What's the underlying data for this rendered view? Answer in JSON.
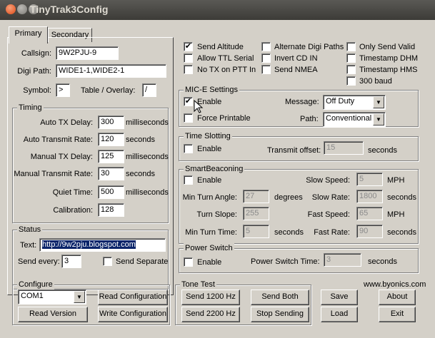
{
  "window": {
    "title": "TinyTrak3Config"
  },
  "tabs": [
    {
      "label": "Primary"
    },
    {
      "label": "Secondary"
    }
  ],
  "primary": {
    "callsign_label": "Callsign:",
    "callsign_value": "9W2PJU-9",
    "digipath_label": "Digi Path:",
    "digipath_value": "WIDE1-1,WIDE2-1",
    "symbol_label": "Symbol:",
    "symbol_value": ">",
    "table_label": "Table / Overlay:",
    "table_value": "/"
  },
  "timing": {
    "title": "Timing",
    "rows": [
      {
        "label": "Auto TX Delay:",
        "value": "300",
        "unit": "milliseconds"
      },
      {
        "label": "Auto Transmit Rate:",
        "value": "120",
        "unit": "seconds"
      },
      {
        "label": "Manual TX Delay:",
        "value": "125",
        "unit": "milliseconds"
      },
      {
        "label": "Manual Transmit Rate:",
        "value": "30",
        "unit": "seconds"
      },
      {
        "label": "Quiet Time:",
        "value": "500",
        "unit": "milliseconds"
      },
      {
        "label": "Calibration:",
        "value": "128",
        "unit": ""
      }
    ]
  },
  "status": {
    "title": "Status",
    "text_label": "Text:",
    "text_value": "http://9w2pju.blogspot.com",
    "send_every_label": "Send every:",
    "send_every_value": "3",
    "send_separate_label": "Send Separate"
  },
  "options": [
    {
      "label": "Send Altitude",
      "checked": true
    },
    {
      "label": "Alternate Digi Paths",
      "checked": false
    },
    {
      "label": "Only Send Valid",
      "checked": false
    },
    {
      "label": "Allow TTL Serial",
      "checked": false
    },
    {
      "label": "Invert CD IN",
      "checked": false
    },
    {
      "label": "Timestamp DHM",
      "checked": false
    },
    {
      "label": "No TX on PTT In",
      "checked": false
    },
    {
      "label": "Send NMEA",
      "checked": false
    },
    {
      "label": "Timestamp HMS",
      "checked": false
    },
    {
      "label": "300 baud",
      "checked": false
    }
  ],
  "mice": {
    "title": "MIC-E Settings",
    "enable_label": "Enable",
    "enable_checked": true,
    "force_label": "Force Printable",
    "force_checked": false,
    "message_label": "Message:",
    "message_value": "Off Duty",
    "path_label": "Path:",
    "path_value": "Conventional"
  },
  "timeslot": {
    "title": "Time Slotting",
    "enable_label": "Enable",
    "offset_label": "Transmit offset:",
    "offset_value": "15",
    "offset_unit": "seconds"
  },
  "smartbeaconing": {
    "title": "SmartBeaconing",
    "enable_label": "Enable",
    "slow_speed_label": "Slow Speed:",
    "slow_speed_value": "5",
    "slow_speed_unit": "MPH",
    "min_turn_angle_label": "Min Turn Angle:",
    "min_turn_angle_value": "27",
    "min_turn_angle_unit": "degrees",
    "slow_rate_label": "Slow Rate:",
    "slow_rate_value": "1800",
    "slow_rate_unit": "seconds",
    "turn_slope_label": "Turn Slope:",
    "turn_slope_value": "255",
    "fast_speed_label": "Fast Speed:",
    "fast_speed_value": "65",
    "fast_speed_unit": "MPH",
    "min_turn_time_label": "Min Turn Time:",
    "min_turn_time_value": "5",
    "min_turn_time_unit": "seconds",
    "fast_rate_label": "Fast Rate:",
    "fast_rate_value": "90",
    "fast_rate_unit": "seconds"
  },
  "power": {
    "title": "Power Switch",
    "enable_label": "Enable",
    "time_label": "Power Switch Time:",
    "time_value": "3",
    "time_unit": "seconds"
  },
  "configure": {
    "title": "Configure",
    "port_value": "COM1",
    "read_config": "Read Configuration",
    "read_version": "Read Version",
    "write_config": "Write Configuration"
  },
  "tone": {
    "title": "Tone Test",
    "send1200": "Send 1200 Hz",
    "send_both": "Send Both",
    "send2200": "Send 2200 Hz",
    "stop": "Stop Sending"
  },
  "footer": {
    "url": "www.byonics.com",
    "save": "Save",
    "about": "About",
    "load": "Load",
    "exit": "Exit"
  },
  "checkmark": "✔"
}
